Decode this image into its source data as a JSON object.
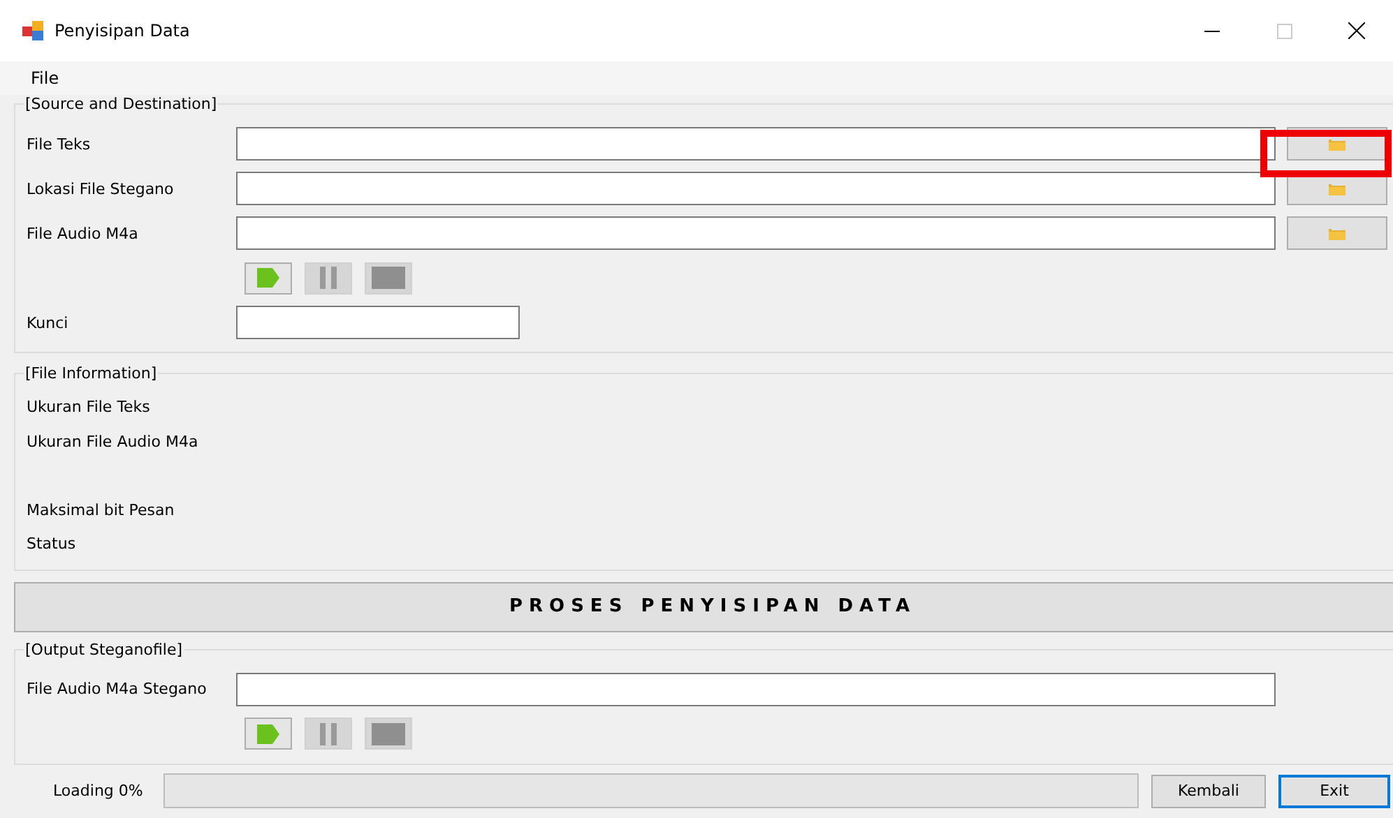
{
  "window": {
    "title": "Penyisipan Data"
  },
  "menu": [
    "File"
  ],
  "source_group": {
    "title": "[Source and Destination]",
    "fields": [
      {
        "label": "File Teks",
        "browse": true
      },
      {
        "label": "Lokasi File Stegano",
        "browse": true
      },
      {
        "label": "File Audio M4a",
        "browse": true
      }
    ],
    "player": [
      {
        "kind": "play",
        "disabled": false
      },
      {
        "kind": "pause",
        "disabled": true
      },
      {
        "kind": "stop",
        "disabled": true
      }
    ],
    "key_field": {
      "label": "Kunci"
    }
  },
  "info_group": {
    "title": "[File Information]",
    "rows": [
      "Ukuran File Teks",
      "Ukuran File Audio M4a",
      "",
      "Maksimal bit Pesan",
      "Status"
    ]
  },
  "process_button": "PROSES PENYISIPAN DATA",
  "output_group": {
    "title": "[Output Steganofile]",
    "field": {
      "label": "File Audio M4a Stegano"
    },
    "player": [
      {
        "kind": "play",
        "disabled": false
      },
      {
        "kind": "pause",
        "disabled": true
      },
      {
        "kind": "stop",
        "disabled": true
      }
    ]
  },
  "status_bar": {
    "loading": "Loading 0%",
    "progress": {
      "level": 0
    },
    "buttons": [
      {
        "label": "Kembali",
        "focused": false
      },
      {
        "label": "Exit",
        "focused": true
      }
    ]
  }
}
